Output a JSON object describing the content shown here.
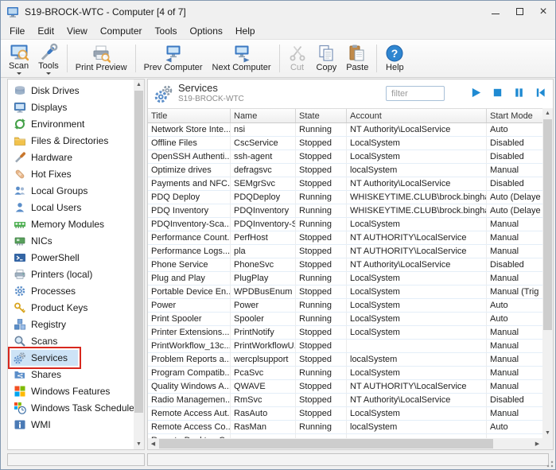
{
  "window": {
    "title": "S19-BROCK-WTC - Computer [4 of 7]"
  },
  "menu": {
    "items": [
      "File",
      "Edit",
      "View",
      "Computer",
      "Tools",
      "Options",
      "Help"
    ]
  },
  "toolbar": {
    "scan": "Scan",
    "tools": "Tools",
    "print_preview": "Print Preview",
    "prev_computer": "Prev Computer",
    "next_computer": "Next Computer",
    "cut": "Cut",
    "copy": "Copy",
    "paste": "Paste",
    "help": "Help"
  },
  "sidebar": {
    "items": [
      {
        "label": "Disk Drives",
        "icon": "disk"
      },
      {
        "label": "Displays",
        "icon": "display"
      },
      {
        "label": "Environment",
        "icon": "environment"
      },
      {
        "label": "Files & Directories",
        "icon": "folder"
      },
      {
        "label": "Hardware",
        "icon": "hardware"
      },
      {
        "label": "Hot Fixes",
        "icon": "hotfix"
      },
      {
        "label": "Local Groups",
        "icon": "groups"
      },
      {
        "label": "Local Users",
        "icon": "user"
      },
      {
        "label": "Memory Modules",
        "icon": "memory"
      },
      {
        "label": "NICs",
        "icon": "nic"
      },
      {
        "label": "PowerShell",
        "icon": "powershell"
      },
      {
        "label": "Printers (local)",
        "icon": "printer"
      },
      {
        "label": "Processes",
        "icon": "processes"
      },
      {
        "label": "Product Keys",
        "icon": "key"
      },
      {
        "label": "Registry",
        "icon": "registry"
      },
      {
        "label": "Scans",
        "icon": "scan"
      },
      {
        "label": "Services",
        "icon": "services",
        "selected": true
      },
      {
        "label": "Shares",
        "icon": "shares"
      },
      {
        "label": "Windows Features",
        "icon": "windows"
      },
      {
        "label": "Windows Task Schedules",
        "icon": "task"
      },
      {
        "label": "WMI",
        "icon": "wmi"
      }
    ]
  },
  "panel": {
    "title": "Services",
    "computer": "S19-BROCK-WTC",
    "filter_placeholder": "filter"
  },
  "table": {
    "columns": [
      "Title",
      "Name",
      "State",
      "Account",
      "Start Mode"
    ],
    "rows": [
      {
        "title": "Network Store Inte...",
        "name": "nsi",
        "state": "Running",
        "account": "NT Authority\\LocalService",
        "start_mode": "Auto"
      },
      {
        "title": "Offline Files",
        "name": "CscService",
        "state": "Stopped",
        "account": "LocalSystem",
        "start_mode": "Disabled"
      },
      {
        "title": "OpenSSH Authenti...",
        "name": "ssh-agent",
        "state": "Stopped",
        "account": "LocalSystem",
        "start_mode": "Disabled"
      },
      {
        "title": "Optimize drives",
        "name": "defragsvc",
        "state": "Stopped",
        "account": "localSystem",
        "start_mode": "Manual"
      },
      {
        "title": "Payments and NFC...",
        "name": "SEMgrSvc",
        "state": "Stopped",
        "account": "NT Authority\\LocalService",
        "start_mode": "Disabled"
      },
      {
        "title": "PDQ Deploy",
        "name": "PDQDeploy",
        "state": "Running",
        "account": "WHISKEYTIME.CLUB\\brock.bingham",
        "start_mode": "Auto (Delaye"
      },
      {
        "title": "PDQ Inventory",
        "name": "PDQInventory",
        "state": "Running",
        "account": "WHISKEYTIME.CLUB\\brock.bingham",
        "start_mode": "Auto (Delaye"
      },
      {
        "title": "PDQInventory-Sca...",
        "name": "PDQInventory-S...",
        "state": "Running",
        "account": "LocalSystem",
        "start_mode": "Manual"
      },
      {
        "title": "Performance Count...",
        "name": "PerfHost",
        "state": "Stopped",
        "account": "NT AUTHORITY\\LocalService",
        "start_mode": "Manual"
      },
      {
        "title": "Performance Logs...",
        "name": "pla",
        "state": "Stopped",
        "account": "NT AUTHORITY\\LocalService",
        "start_mode": "Manual"
      },
      {
        "title": "Phone Service",
        "name": "PhoneSvc",
        "state": "Stopped",
        "account": "NT Authority\\LocalService",
        "start_mode": "Disabled"
      },
      {
        "title": "Plug and Play",
        "name": "PlugPlay",
        "state": "Running",
        "account": "LocalSystem",
        "start_mode": "Manual"
      },
      {
        "title": "Portable Device En...",
        "name": "WPDBusEnum",
        "state": "Stopped",
        "account": "LocalSystem",
        "start_mode": "Manual (Trig"
      },
      {
        "title": "Power",
        "name": "Power",
        "state": "Running",
        "account": "LocalSystem",
        "start_mode": "Auto"
      },
      {
        "title": "Print Spooler",
        "name": "Spooler",
        "state": "Running",
        "account": "LocalSystem",
        "start_mode": "Auto"
      },
      {
        "title": "Printer Extensions...",
        "name": "PrintNotify",
        "state": "Stopped",
        "account": "LocalSystem",
        "start_mode": "Manual"
      },
      {
        "title": "PrintWorkflow_13c...",
        "name": "PrintWorkflowU...",
        "state": "Stopped",
        "account": "",
        "start_mode": "Manual"
      },
      {
        "title": "Problem Reports a...",
        "name": "wercplsupport",
        "state": "Stopped",
        "account": "localSystem",
        "start_mode": "Manual"
      },
      {
        "title": "Program Compatib...",
        "name": "PcaSvc",
        "state": "Running",
        "account": "LocalSystem",
        "start_mode": "Manual"
      },
      {
        "title": "Quality Windows A...",
        "name": "QWAVE",
        "state": "Stopped",
        "account": "NT AUTHORITY\\LocalService",
        "start_mode": "Manual"
      },
      {
        "title": "Radio Managemen...",
        "name": "RmSvc",
        "state": "Stopped",
        "account": "NT Authority\\LocalService",
        "start_mode": "Disabled"
      },
      {
        "title": "Remote Access Aut...",
        "name": "RasAuto",
        "state": "Stopped",
        "account": "LocalSystem",
        "start_mode": "Manual"
      },
      {
        "title": "Remote Access Co...",
        "name": "RasMan",
        "state": "Running",
        "account": "localSystem",
        "start_mode": "Auto"
      },
      {
        "title": "Remote Desktop C...",
        "name": "",
        "state": "",
        "account": "",
        "start_mode": ""
      }
    ]
  },
  "colors": {
    "accent_blue": "#1f8ad2",
    "selection_blue": "#cde3f6",
    "annotation_red": "#d7281e"
  }
}
